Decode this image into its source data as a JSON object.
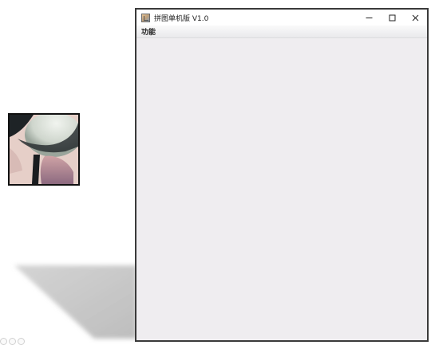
{
  "window": {
    "title": "拼图单机版 V1.0",
    "controls": {
      "minimize_glyph": "—",
      "maximize_glyph": "☐",
      "close_glyph": "✕"
    }
  },
  "menubar": {
    "items": [
      {
        "label": "功能"
      }
    ]
  },
  "icons": {
    "app_icon": "java-app-icon",
    "tile": "puzzle-tile-image"
  },
  "colors": {
    "window_border": "#3a3a3a",
    "content_bg": "#efedf0",
    "titlebar_bg": "#ffffff"
  }
}
